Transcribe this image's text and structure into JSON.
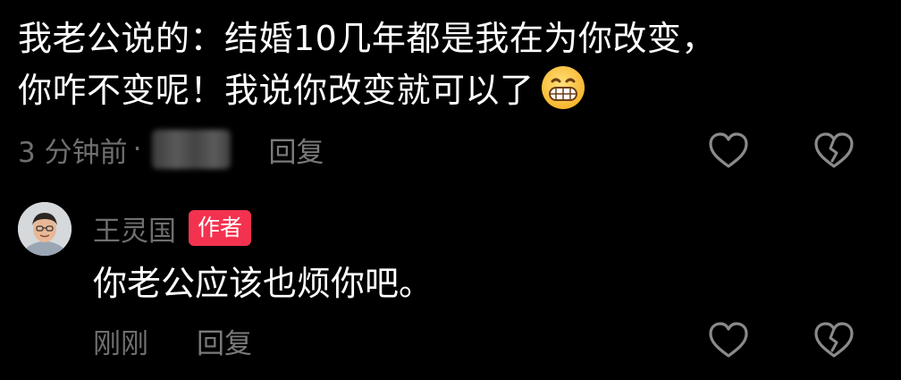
{
  "comment": {
    "line1": "我老公说的：结婚10几年都是我在为你改变，",
    "line2": "你咋不变呢！我说你改变就可以了",
    "emoji_icon": "grinning-face-emoji",
    "time": "3 分钟前",
    "separator": "·",
    "reply_label": "回复",
    "like_icon": "heart-outline-icon",
    "dislike_icon": "broken-heart-icon"
  },
  "reply": {
    "author_name": "王灵国",
    "author_badge": "作者",
    "text": "你老公应该也烦你吧。",
    "time": "刚刚",
    "reply_label": "回复",
    "like_icon": "heart-outline-icon",
    "dislike_icon": "broken-heart-icon"
  },
  "colors": {
    "background": "#000000",
    "primary_text": "#ffffff",
    "secondary_text": "#6f6f6f",
    "badge": "#f3324f"
  }
}
